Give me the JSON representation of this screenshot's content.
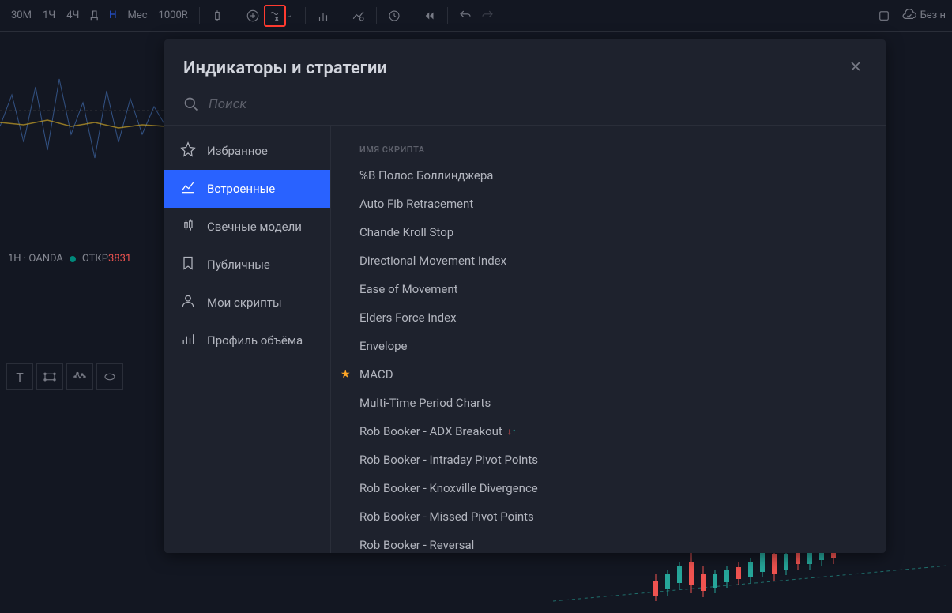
{
  "toolbar": {
    "timeframes": [
      "30М",
      "1Ч",
      "4Ч",
      "Д",
      "Н",
      "Мес",
      "1000R"
    ],
    "active_timeframe": 4,
    "cloud_status": "Без н"
  },
  "chart": {
    "info_text": "1Н · OANDA",
    "status_label": "ОТКР",
    "price": "3831"
  },
  "modal": {
    "title": "Индикаторы и стратегии",
    "search_placeholder": "Поиск",
    "sidebar": {
      "active": 1,
      "items": [
        {
          "label": "Избранное",
          "icon": "star"
        },
        {
          "label": "Встроенные",
          "icon": "builtin"
        },
        {
          "label": "Свечные модели",
          "icon": "candle"
        },
        {
          "label": "Публичные",
          "icon": "bookmark"
        },
        {
          "label": "Мои скрипты",
          "icon": "person"
        },
        {
          "label": "Профиль объёма",
          "icon": "volume"
        }
      ]
    },
    "list_header": "ИМЯ СКРИПТА",
    "scripts": [
      {
        "label": "%В Полос Боллинджера"
      },
      {
        "label": "Auto Fib Retracement"
      },
      {
        "label": "Chande Kroll Stop"
      },
      {
        "label": "Directional Movement Index"
      },
      {
        "label": "Ease of Movement"
      },
      {
        "label": "Elders Force Index"
      },
      {
        "label": "Envelope"
      },
      {
        "label": "MACD",
        "favorite": true
      },
      {
        "label": "Multi-Time Period Charts"
      },
      {
        "label": "Rob Booker - ADX Breakout",
        "strategy": true
      },
      {
        "label": "Rob Booker - Intraday Pivot Points"
      },
      {
        "label": "Rob Booker - Knoxville Divergence"
      },
      {
        "label": "Rob Booker - Missed Pivot Points"
      },
      {
        "label": "Rob Booker - Reversal"
      }
    ]
  }
}
